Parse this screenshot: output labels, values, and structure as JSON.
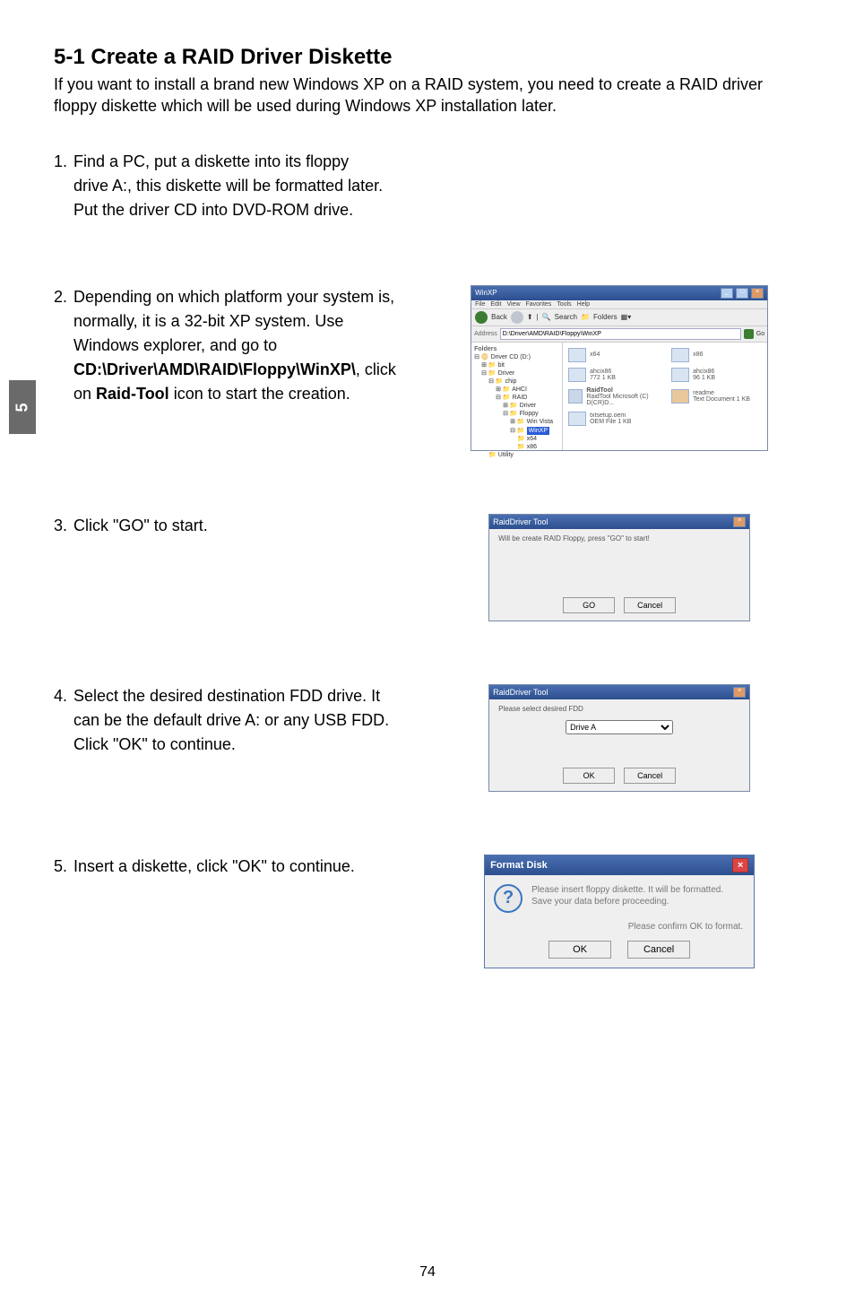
{
  "side_tab": "5",
  "title": "5-1 Create a RAID Driver Diskette",
  "intro": "If you want to install a brand new Windows XP on a RAID system, you need to create a RAID driver floppy diskette which will be used during Windows XP installation later.",
  "steps": {
    "s1": {
      "num": "1.",
      "line1": "Find a PC, put a diskette into its floppy",
      "line2": "drive A:, this diskette will be formatted later.",
      "line3": "Put the driver CD into DVD-ROM drive."
    },
    "s2": {
      "num": "2.",
      "pre": "Depending on which platform your system is, normally, it is a 32-bit XP system. Use Windows explorer, and go to ",
      "path": "CD:\\Driver\\AMD\\RAID\\Floppy\\WinXP\\",
      "mid": ", click on ",
      "tool": "Raid-Tool",
      "post": " icon to start the creation."
    },
    "s3": {
      "num": "3.",
      "text": "Click \"GO\" to start."
    },
    "s4": {
      "num": "4.",
      "text": "Select the desired destination FDD drive. It can be the default drive A: or any USB FDD. Click \"OK\" to continue."
    },
    "s5": {
      "num": "5.",
      "text": "Insert a diskette, click \"OK\" to continue."
    }
  },
  "explorer": {
    "title": "WinXP",
    "menu": {
      "file": "File",
      "edit": "Edit",
      "view": "View",
      "fav": "Favorites",
      "tools": "Tools",
      "help": "Help"
    },
    "toolbar": {
      "back": "Back",
      "search": "Search",
      "folders": "Folders"
    },
    "address_label": "Address",
    "address_value": "D:\\Driver\\AMD\\RAID\\Floppy\\WinXP",
    "go": "Go",
    "tree_header": "Folders",
    "tree": [
      "Driver CD (D:)",
      "bit",
      "Driver",
      "chip",
      "AHCI",
      "RAID",
      "Driver",
      "Floppy",
      "Win Vista",
      "WinXP",
      "x64",
      "x86",
      "Utility"
    ],
    "tree_selected": "WinXP",
    "icons": [
      {
        "name": "x64",
        "sub": ""
      },
      {
        "name": "x86",
        "sub": ""
      },
      {
        "name": "ahcix86",
        "sub": "772\n1 KB"
      },
      {
        "name": "ahcix86",
        "sub": "96\n1 KB"
      },
      {
        "name": "RaidTool",
        "sub": "RaidTool Microsoft (C) D(CR)D..."
      },
      {
        "name": "readme",
        "sub": "Text Document\n1 KB"
      },
      {
        "name": "txtsetup.oem",
        "sub": "OEM File\n1 KB"
      }
    ]
  },
  "dlg_go": {
    "title": "RaidDriver Tool",
    "text": "Will be create RAID Floppy, press \"GO\" to start!",
    "btn_go": "GO",
    "btn_cancel": "Cancel"
  },
  "dlg_fdd": {
    "title": "RaidDriver Tool",
    "text": "Please select desired FDD",
    "label": "Drive A",
    "btn_ok": "OK",
    "btn_cancel": "Cancel"
  },
  "msg": {
    "title": "Format Disk",
    "line1": "Please insert floppy diskette.  It will be formatted.",
    "line2": "Save your data before proceeding.",
    "confirm": "Please confirm OK to format.",
    "btn_ok": "OK",
    "btn_cancel": "Cancel"
  },
  "page_number": "74"
}
